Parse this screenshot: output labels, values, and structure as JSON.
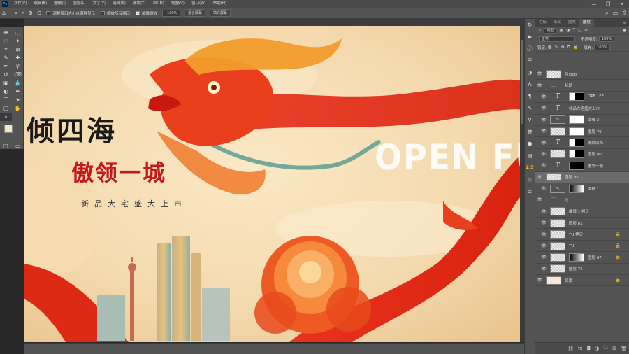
{
  "menubar": {
    "logo": "Ps",
    "items": [
      "文件(F)",
      "编辑(E)",
      "图像(I)",
      "图层(L)",
      "文字(Y)",
      "选择(S)",
      "滤镜(T)",
      "3D(D)",
      "视图(V)",
      "窗口(W)",
      "帮助(H)"
    ],
    "window_controls": [
      "—",
      "❐",
      "✕"
    ]
  },
  "options": {
    "resize_windows": "调整窗口大小以满屏显示",
    "zoom_all": "缩放所有窗口",
    "scrubby_zoom": "细微缩放",
    "zoom_value": "100%",
    "fit_screen": "适合屏幕",
    "fill_screen": "填充屏幕"
  },
  "artwork": {
    "headline1": "倾四海",
    "headline2": "傲领一城",
    "subtitle": "新品大宅盛大上市",
    "open_text": "OPEN FUT"
  },
  "panel": {
    "tabs": [
      "色板",
      "渐变",
      "图案",
      "图层"
    ],
    "kind_label": "类型",
    "blend_mode": "正常",
    "opacity_label": "不透明度:",
    "opacity_value": "100%",
    "lock_label": "锁定:",
    "fill_label": "填充:",
    "fill_value": "100%"
  },
  "layers": [
    {
      "name": "月logo",
      "type": "image"
    },
    {
      "name": "标题",
      "type": "folder"
    },
    {
      "name": "OPE...FE",
      "type": "text-mask"
    },
    {
      "name": "倾品大宅盛大上市",
      "type": "text"
    },
    {
      "name": "曲线 2",
      "type": "adj"
    },
    {
      "name": "图层 79",
      "type": "image-mask"
    },
    {
      "name": "城领四海",
      "type": "text-mask"
    },
    {
      "name": "图层 80",
      "type": "image-mask"
    },
    {
      "name": "傲领一城",
      "type": "text-mask"
    },
    {
      "name": "图层 85",
      "type": "image",
      "selected": true
    },
    {
      "name": "曲线 1",
      "type": "adj-mask"
    },
    {
      "name": "龙",
      "type": "folder"
    },
    {
      "name": "曲线 1 拷贝",
      "type": "adj"
    },
    {
      "name": "图层 81",
      "type": "image"
    },
    {
      "name": "TU 拷贝",
      "type": "image",
      "lock": true
    },
    {
      "name": "TU",
      "type": "image",
      "lock": true
    },
    {
      "name": "图层 67",
      "type": "image-mask"
    },
    {
      "name": "图层 75",
      "type": "image"
    },
    {
      "name": "背景",
      "type": "solid",
      "lock": true
    }
  ],
  "strip_badge": "2.5"
}
